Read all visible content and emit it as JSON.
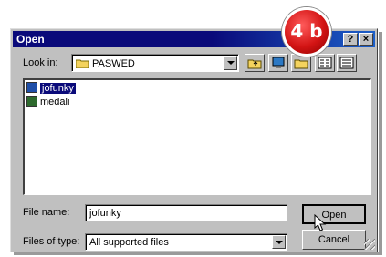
{
  "window": {
    "title": "Open",
    "help_btn": "?",
    "close_btn": "×"
  },
  "badge": {
    "text": "4 b"
  },
  "lookin": {
    "label": "Look in:",
    "value": "PASWED"
  },
  "files": [
    {
      "name": "jofunky",
      "selected": true
    },
    {
      "name": "medali",
      "selected": false
    }
  ],
  "filename": {
    "label": "File name:",
    "value": "jofunky"
  },
  "filetype": {
    "label": "Files of type:",
    "value": "All supported files"
  },
  "buttons": {
    "open": "Open",
    "cancel": "Cancel"
  },
  "colors": {
    "titlebar": "#0a0a7a",
    "badge": "#d31414",
    "selection": "#0a0a7a"
  }
}
